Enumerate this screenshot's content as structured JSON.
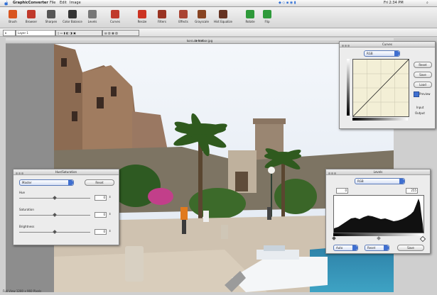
{
  "menubar": {
    "app_menu": "GraphicConverter",
    "items": [
      "File",
      "Edit",
      "Image"
    ],
    "right_text": "Fri 2:34 PM"
  },
  "toolbar": {
    "tools": [
      {
        "label": "Brush",
        "icon": "pencil-icon",
        "color": "#d9541e"
      },
      {
        "label": "Browser",
        "icon": "brush-icon",
        "color": "#c0392b"
      },
      {
        "label": "Sharpen",
        "icon": "sharpen-icon",
        "color": "#555555"
      },
      {
        "label": "Color Balance",
        "icon": "color-balance-icon",
        "color": "#333333"
      },
      {
        "label": "Levels",
        "icon": "levels-icon",
        "color": "#777777"
      },
      {
        "label": "Curves",
        "icon": "curves-icon",
        "color": "#c0392b"
      },
      {
        "label": "Resize",
        "icon": "resize-icon",
        "color": "#cc3322"
      },
      {
        "label": "Filters",
        "icon": "filters-icon",
        "color": "#993322"
      },
      {
        "label": "Effects",
        "icon": "effects-icon",
        "color": "#aa4433"
      },
      {
        "label": "Grayscale",
        "icon": "grayscale-icon",
        "color": "#884422"
      },
      {
        "label": "Hist Equalize",
        "icon": "equalize-icon",
        "color": "#663322"
      },
      {
        "label": "Rotate",
        "icon": "rotate-icon",
        "color": "#2e9a3a"
      },
      {
        "label": "Flip",
        "icon": "flip-icon",
        "color": "#2e9a3a"
      }
    ]
  },
  "optbar": {
    "layer_select": "Layer 1"
  },
  "document": {
    "title": "korcula-harbor.jpg"
  },
  "curves_panel": {
    "title": "Curves",
    "channel": "RGB",
    "buttons": [
      "Reset",
      "Save",
      "Load"
    ],
    "preview_label": "Preview",
    "input_label": "Input",
    "output_label": "Output"
  },
  "adjust_panel": {
    "title": "Hue/Saturation",
    "channel": "Master",
    "reset_label": "Reset",
    "sliders": [
      {
        "label": "Hue",
        "value": "0",
        "position": 0.5
      },
      {
        "label": "Saturation",
        "value": "0",
        "position": 0.5
      },
      {
        "label": "Brightness",
        "value": "0",
        "position": 0.5
      }
    ]
  },
  "levels_panel": {
    "title": "Levels",
    "channel": "RGB",
    "input_low": "0",
    "input_high": "255",
    "buttons": [
      "Auto",
      "Reset",
      "Save"
    ]
  },
  "status": {
    "text": "Full View 1280 x 960 Pixels"
  }
}
